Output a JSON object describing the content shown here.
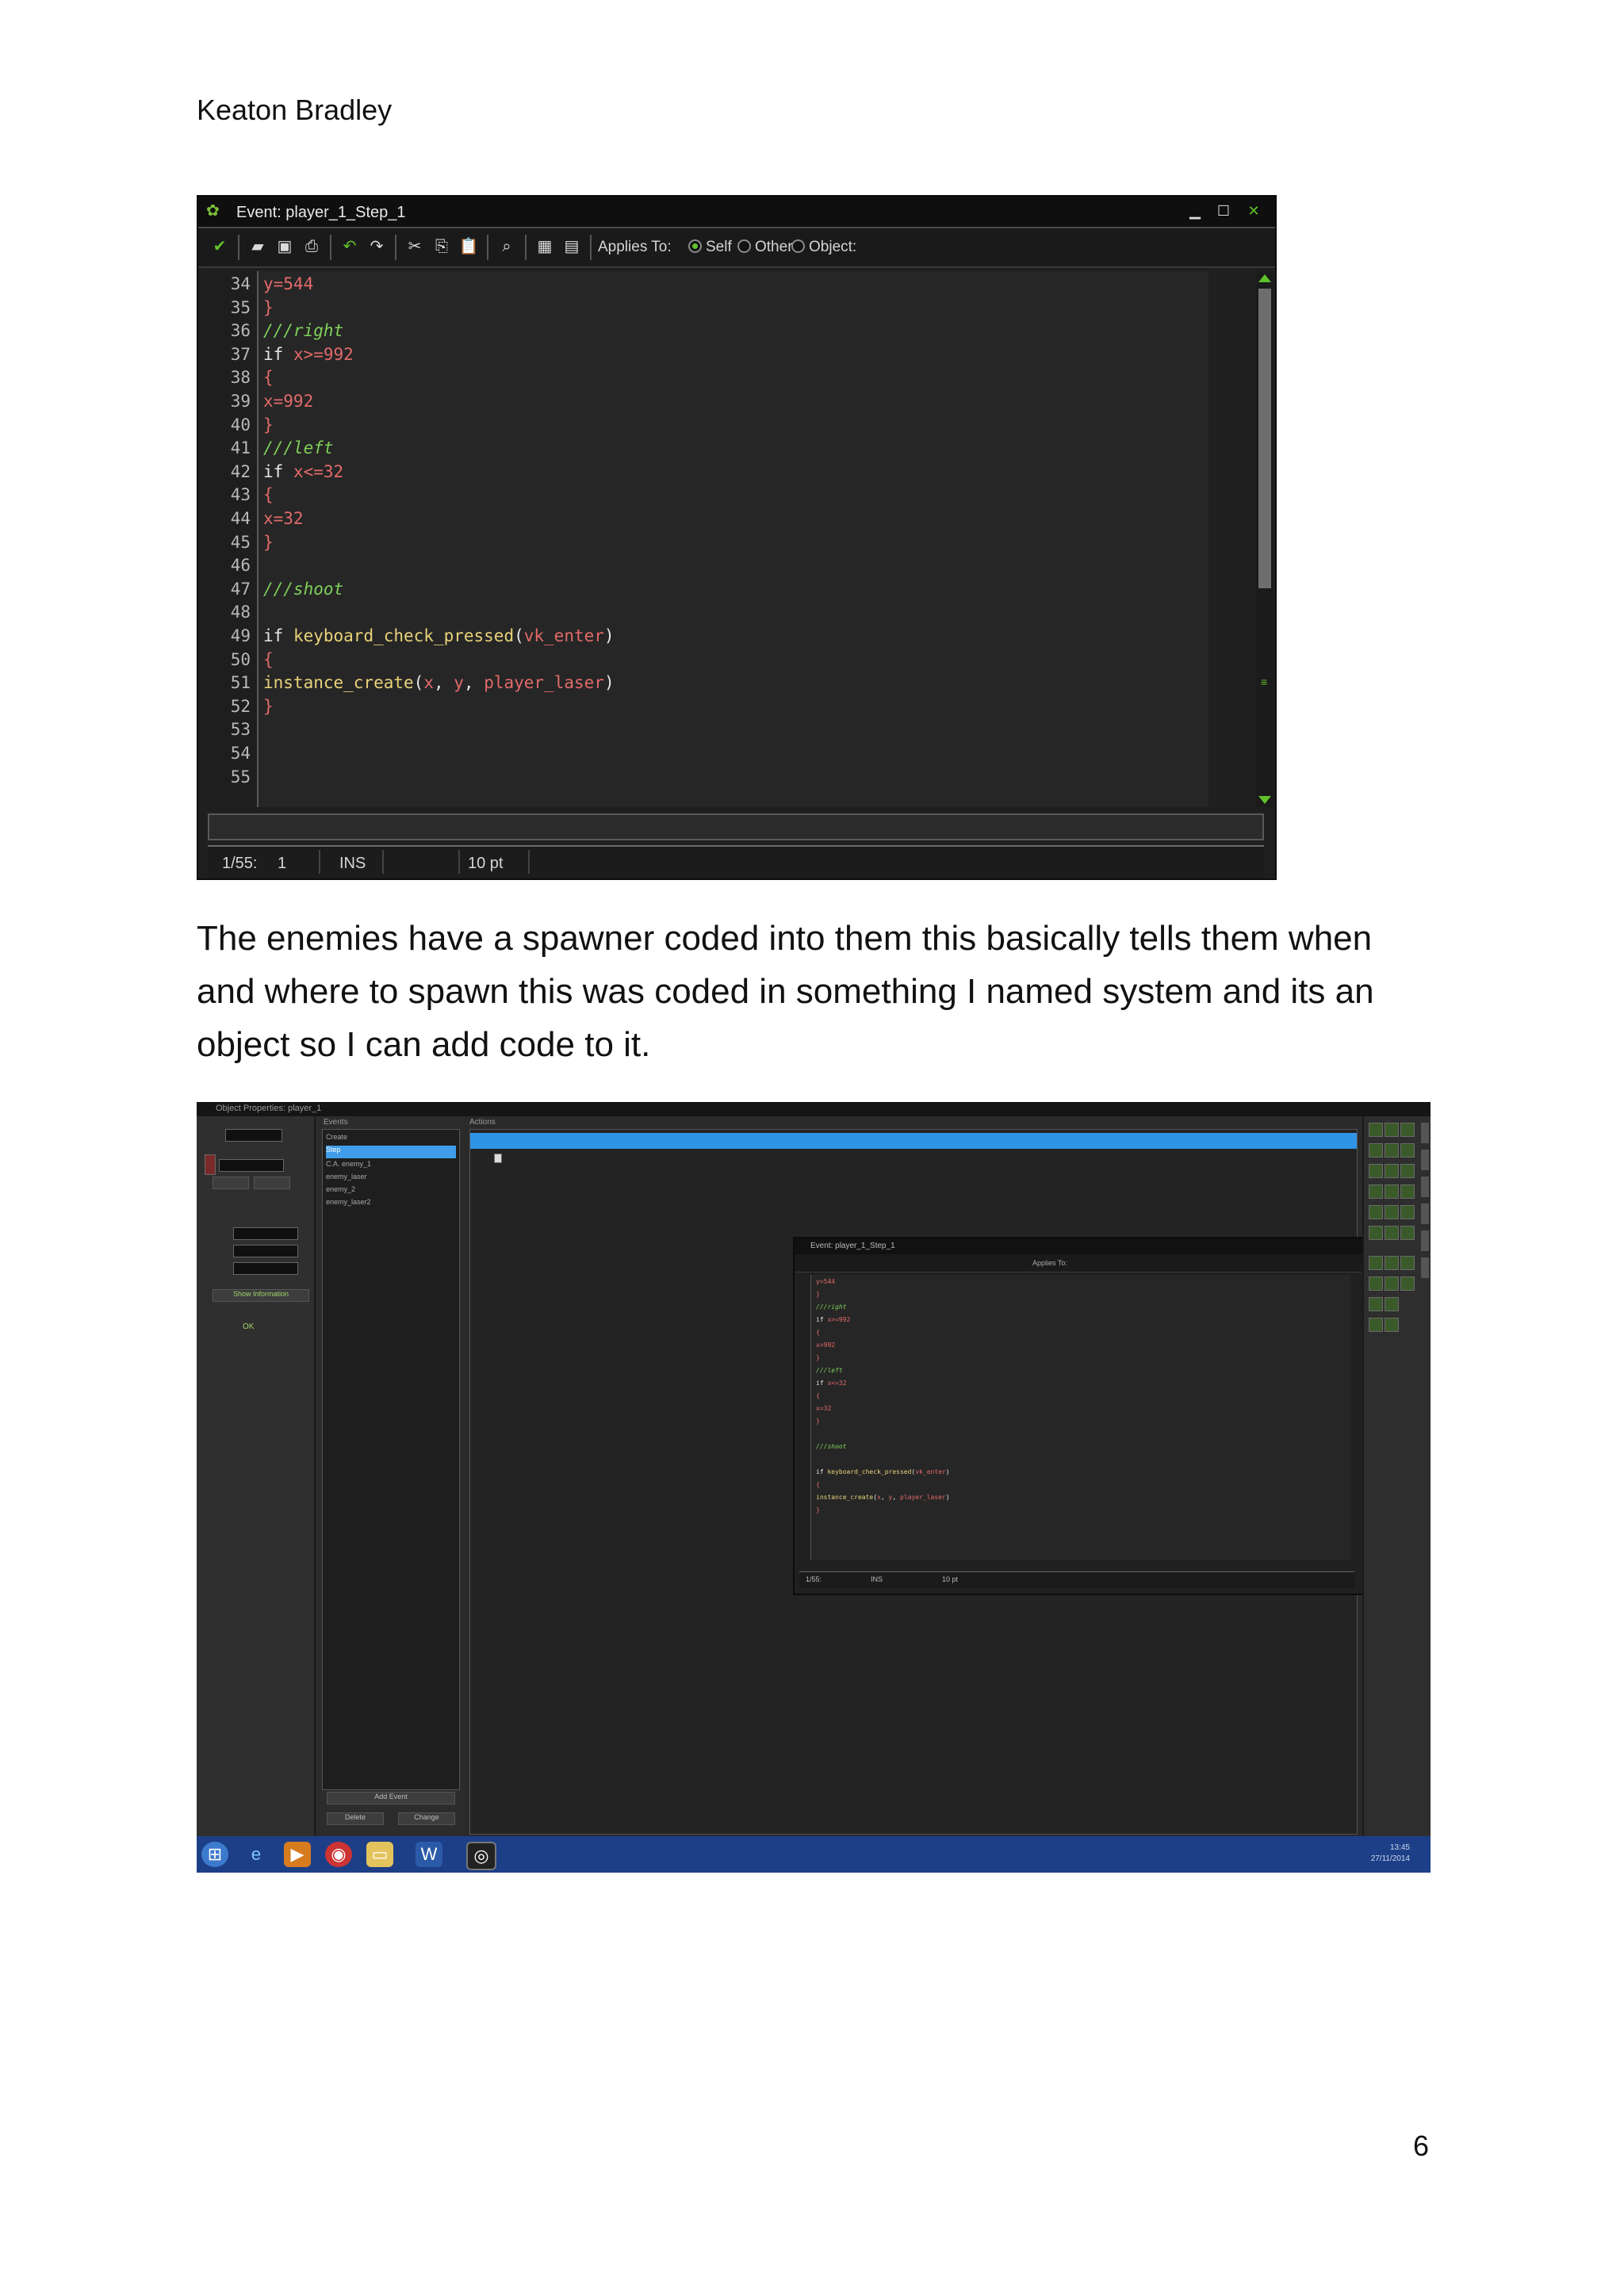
{
  "document": {
    "author": "Keaton Bradley",
    "page_number": "6",
    "paragraph_lines": [
      "The enemies have a spawner coded into them this basically tells them when",
      "and where to spawn this was coded in something I named system and its an",
      "object so I can add code to it."
    ]
  },
  "editor": {
    "title": "Event: player_1_Step_1",
    "applies_to_label": "Applies To:",
    "options": [
      "Self",
      "Other",
      "Object:"
    ],
    "selected_option": "Self",
    "status": {
      "position": "1/55:",
      "column": "1",
      "mode": "INS",
      "font_size": "10 pt"
    },
    "line_numbers": [
      "34",
      "35",
      "36",
      "37",
      "38",
      "39",
      "40",
      "41",
      "42",
      "43",
      "44",
      "45",
      "46",
      "47",
      "48",
      "49",
      "50",
      "51",
      "52",
      "53",
      "54",
      "55"
    ],
    "code_lines": [
      [
        {
          "t": "y=544",
          "c": "num"
        }
      ],
      [
        {
          "t": "}",
          "c": "num"
        }
      ],
      [
        {
          "t": "///right",
          "c": "cmt"
        }
      ],
      [
        {
          "t": "if ",
          "c": "kw"
        },
        {
          "t": "x>=992",
          "c": "num"
        }
      ],
      [
        {
          "t": "{",
          "c": "num"
        }
      ],
      [
        {
          "t": "x=992",
          "c": "num"
        }
      ],
      [
        {
          "t": "}",
          "c": "num"
        }
      ],
      [
        {
          "t": "///left",
          "c": "cmt"
        }
      ],
      [
        {
          "t": "if ",
          "c": "kw"
        },
        {
          "t": "x<=32",
          "c": "num"
        }
      ],
      [
        {
          "t": "{",
          "c": "num"
        }
      ],
      [
        {
          "t": "x=32",
          "c": "num"
        }
      ],
      [
        {
          "t": "}",
          "c": "num"
        }
      ],
      [],
      [
        {
          "t": "///shoot",
          "c": "cmt"
        }
      ],
      [],
      [
        {
          "t": "if ",
          "c": "kw"
        },
        {
          "t": "keyboard_check_pressed",
          "c": "fn"
        },
        {
          "t": "(",
          "c": "kw"
        },
        {
          "t": "vk_enter",
          "c": "num"
        },
        {
          "t": ")",
          "c": "kw"
        }
      ],
      [
        {
          "t": "{",
          "c": "num"
        }
      ],
      [
        {
          "t": "instance_create",
          "c": "fn"
        },
        {
          "t": "(",
          "c": "kw"
        },
        {
          "t": "x",
          "c": "num"
        },
        {
          "t": ", ",
          "c": "kw"
        },
        {
          "t": "y",
          "c": "num"
        },
        {
          "t": ", ",
          "c": "kw"
        },
        {
          "t": "player_laser",
          "c": "num"
        },
        {
          "t": ")",
          "c": "kw"
        }
      ],
      [
        {
          "t": "}",
          "c": "num"
        }
      ],
      [],
      [],
      []
    ],
    "colors": {
      "kw": "#e8e8e8",
      "num": "#e36a6a",
      "cmt": "#7fd05a",
      "fn": "#e8d37a",
      "accent": "#5fc22b"
    }
  },
  "ide": {
    "title": "Object Properties: player_1",
    "events_heading": "Events",
    "actions_heading": "Actions",
    "events": [
      "Create",
      "Step",
      "C.A. enemy_1",
      "enemy_laser",
      "enemy_2",
      "enemy_laser2"
    ],
    "selected_event": "Step",
    "ok_label": "OK",
    "add_event_label": "Add Event",
    "delete_label": "Delete",
    "change_label": "Change",
    "show_info_label": "Show Information",
    "taskbar_clock": [
      "13:45",
      "27/11/2014"
    ],
    "taskbar_apps": [
      "start-orb",
      "ie",
      "media",
      "chrome",
      "explorer",
      "word",
      "gamemaker"
    ]
  }
}
